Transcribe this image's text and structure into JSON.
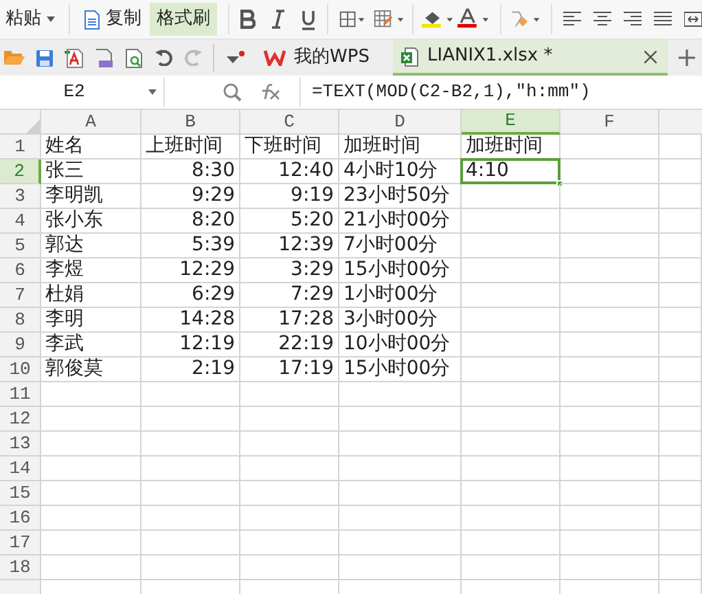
{
  "toolbar": {
    "paste": "粘贴",
    "copy": "复制",
    "format_painter": {
      "label": "格式刷",
      "selected": true
    }
  },
  "tabs": [
    {
      "label": "我的WPS",
      "selected": false
    },
    {
      "label": "LIANIX1.xlsx *",
      "selected": true
    }
  ],
  "formula_bar": {
    "cell": "E2",
    "formula": "=TEXT(MOD(C2-B2,1),\"h:mm\")"
  },
  "columns": [
    {
      "label": "A",
      "selected": false,
      "kind": "text"
    },
    {
      "label": "B",
      "selected": false,
      "kind": "time"
    },
    {
      "label": "C",
      "selected": false,
      "kind": "time"
    },
    {
      "label": "D",
      "selected": false,
      "kind": "text"
    },
    {
      "label": "E",
      "selected": true,
      "kind": "text"
    },
    {
      "label": "F",
      "selected": false,
      "kind": "text"
    }
  ],
  "rows": [
    {
      "number": "1",
      "selected": false,
      "kind": "header",
      "cells": [
        "姓名",
        "上班时间",
        "下班时间",
        "加班时间",
        "加班时间"
      ]
    },
    {
      "number": "2",
      "selected": true,
      "kind": "data",
      "cells": [
        "张三",
        "8:30",
        "12:40",
        "4小时10分",
        "4:10"
      ]
    },
    {
      "number": "3",
      "selected": false,
      "kind": "data",
      "cells": [
        "李明凯",
        "9:29",
        "9:19",
        "23小时50分"
      ]
    },
    {
      "number": "4",
      "selected": false,
      "kind": "data",
      "cells": [
        "张小东",
        "8:20",
        "5:20",
        "21小时00分"
      ]
    },
    {
      "number": "5",
      "selected": false,
      "kind": "data",
      "cells": [
        "郭达",
        "5:39",
        "12:39",
        "7小时00分"
      ]
    },
    {
      "number": "6",
      "selected": false,
      "kind": "data",
      "cells": [
        "李煜",
        "12:29",
        "3:29",
        "15小时00分"
      ]
    },
    {
      "number": "7",
      "selected": false,
      "kind": "data",
      "cells": [
        "杜娟",
        "6:29",
        "7:29",
        "1小时00分"
      ]
    },
    {
      "number": "8",
      "selected": false,
      "kind": "data",
      "cells": [
        "李明",
        "14:28",
        "17:28",
        "3小时00分"
      ]
    },
    {
      "number": "9",
      "selected": false,
      "kind": "data",
      "cells": [
        "李武",
        "12:19",
        "22:19",
        "10小时00分"
      ]
    },
    {
      "number": "10",
      "selected": false,
      "kind": "data",
      "cells": [
        "郭俊莫",
        "2:19",
        "17:19",
        "15小时00分"
      ]
    },
    {
      "number": "11",
      "selected": false
    },
    {
      "number": "12",
      "selected": false
    },
    {
      "number": "13",
      "selected": false
    },
    {
      "number": "14",
      "selected": false
    },
    {
      "number": "15",
      "selected": false
    },
    {
      "number": "16",
      "selected": false
    },
    {
      "number": "17",
      "selected": false
    },
    {
      "number": "18",
      "selected": false
    }
  ]
}
